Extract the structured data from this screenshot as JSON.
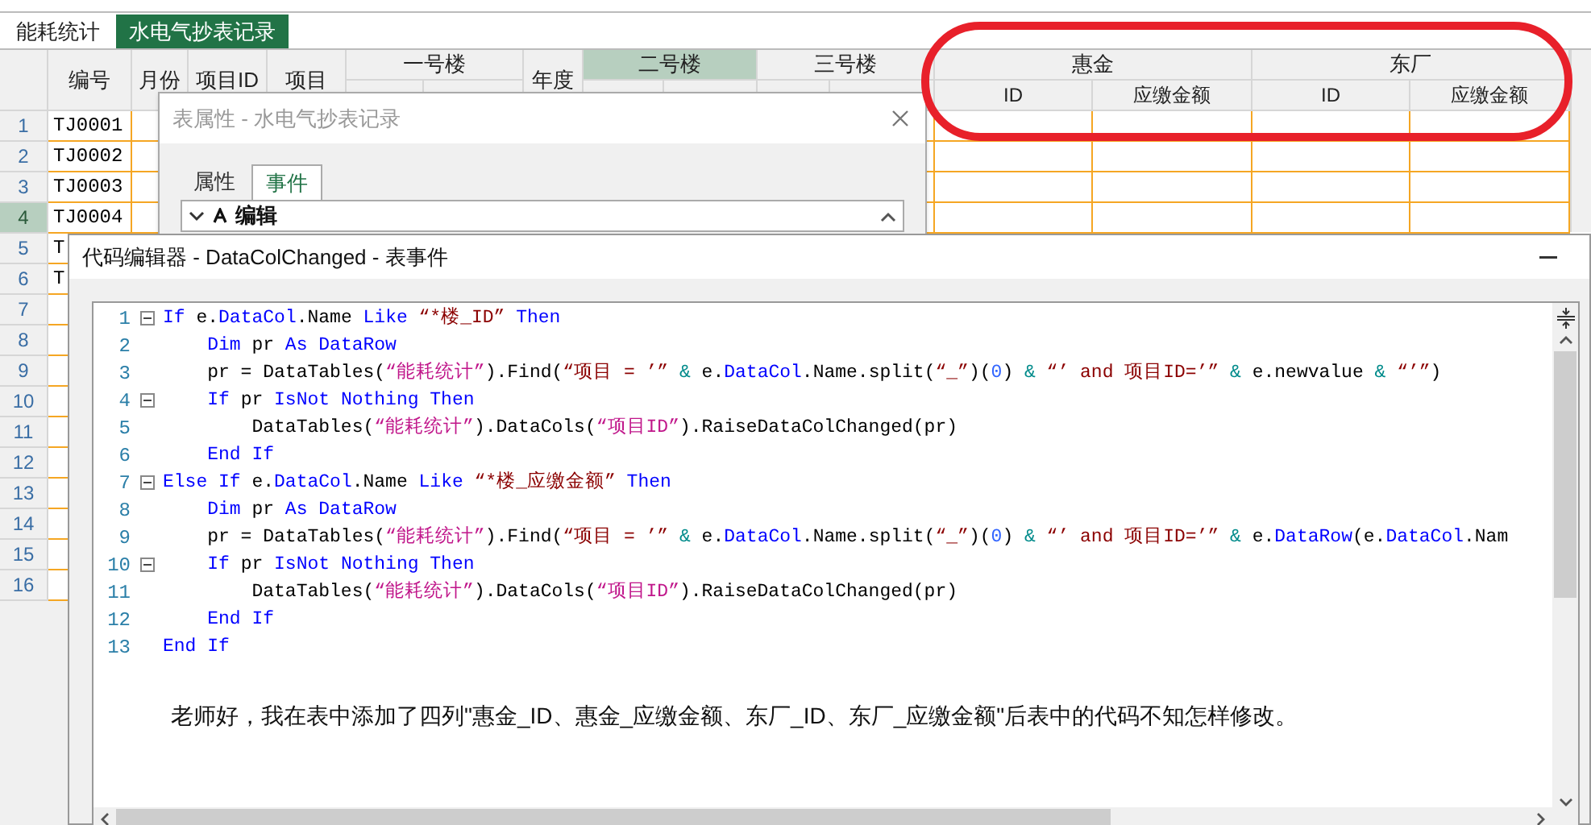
{
  "sheet_tabs": [
    {
      "label": "能耗统计",
      "selected": false
    },
    {
      "label": "水电气抄表记录",
      "selected": true
    }
  ],
  "grid": {
    "headers": [
      {
        "kind": "single",
        "label": "编号",
        "selected": false
      },
      {
        "kind": "single",
        "label": "月份",
        "selected": false
      },
      {
        "kind": "single",
        "label": "项目ID",
        "selected": false
      },
      {
        "kind": "single",
        "label": "项目",
        "selected": false
      },
      {
        "kind": "group",
        "label": "一号楼",
        "selected": false
      },
      {
        "kind": "single",
        "label": "年度",
        "selected": false
      },
      {
        "kind": "group",
        "label": "二号楼",
        "selected": true
      },
      {
        "kind": "group",
        "label": "三号楼",
        "selected": false
      },
      {
        "kind": "group",
        "label": "惠金",
        "selected": false,
        "sub": [
          "ID",
          "应缴金额"
        ]
      },
      {
        "kind": "group",
        "label": "东厂",
        "selected": false,
        "sub": [
          "ID",
          "应缴金额"
        ]
      }
    ],
    "rows": [
      {
        "num": "1",
        "selected": false,
        "code": "TJ0001"
      },
      {
        "num": "2",
        "selected": false,
        "code": "TJ0002"
      },
      {
        "num": "3",
        "selected": false,
        "code": "TJ0003"
      },
      {
        "num": "4",
        "selected": true,
        "code": "TJ0004"
      },
      {
        "num": "5",
        "selected": false,
        "code": "T"
      },
      {
        "num": "6",
        "selected": false,
        "code": "T"
      },
      {
        "num": "7",
        "selected": false
      },
      {
        "num": "8",
        "selected": false
      },
      {
        "num": "9",
        "selected": false
      },
      {
        "num": "10",
        "selected": false
      },
      {
        "num": "11",
        "selected": false
      },
      {
        "num": "12",
        "selected": false
      },
      {
        "num": "13",
        "selected": false
      },
      {
        "num": "14",
        "selected": false
      },
      {
        "num": "15",
        "selected": false
      },
      {
        "num": "16",
        "selected": false
      }
    ]
  },
  "properties_dialog": {
    "title": "表属性 - 水电气抄表记录",
    "tabs": [
      {
        "label": "属性",
        "selected": false
      },
      {
        "label": "事件",
        "selected": true
      }
    ],
    "section": {
      "label": "编辑",
      "expanded": true
    }
  },
  "code_editor": {
    "title": "代码编辑器 - DataColChanged - 表事件",
    "lines": [
      {
        "num": "1",
        "fold": true,
        "tokens": [
          {
            "text": "If",
            "kind": "kw"
          },
          {
            "text": " e.",
            "kind": "tx"
          },
          {
            "text": "DataCol",
            "kind": "kw"
          },
          {
            "text": ".Name ",
            "kind": "tx"
          },
          {
            "text": "Like",
            "kind": "kw"
          },
          {
            "text": " “*楼_ID”",
            "kind": "str"
          },
          {
            "text": " Then",
            "kind": "kw"
          }
        ]
      },
      {
        "num": "2",
        "fold": false,
        "tokens": [
          {
            "text": "    Dim",
            "kind": "kw"
          },
          {
            "text": " pr ",
            "kind": "tx"
          },
          {
            "text": "As",
            "kind": "kw"
          },
          {
            "text": " DataRow",
            "kind": "kw"
          }
        ]
      },
      {
        "num": "3",
        "fold": false,
        "tokens": [
          {
            "text": "    pr = DataTables(",
            "kind": "tx"
          },
          {
            "text": "“能耗统计”",
            "kind": "cn"
          },
          {
            "text": ").Find(",
            "kind": "tx"
          },
          {
            "text": "“项目 = ’”",
            "kind": "str"
          },
          {
            "text": " &",
            "kind": "op"
          },
          {
            "text": " e.",
            "kind": "tx"
          },
          {
            "text": "DataCol",
            "kind": "kw"
          },
          {
            "text": ".Name.split(",
            "kind": "tx"
          },
          {
            "text": "“_”",
            "kind": "str"
          },
          {
            "text": ")(",
            "kind": "tx"
          },
          {
            "text": "0",
            "kind": "num"
          },
          {
            "text": ") ",
            "kind": "tx"
          },
          {
            "text": "&",
            "kind": "op"
          },
          {
            "text": " “’ and 项目ID=’”",
            "kind": "str"
          },
          {
            "text": " &",
            "kind": "op"
          },
          {
            "text": " e.newvalue ",
            "kind": "tx"
          },
          {
            "text": "&",
            "kind": "op"
          },
          {
            "text": " “’”",
            "kind": "str"
          },
          {
            "text": ")",
            "kind": "tx"
          }
        ]
      },
      {
        "num": "4",
        "fold": true,
        "tokens": [
          {
            "text": "    If",
            "kind": "kw"
          },
          {
            "text": " pr ",
            "kind": "tx"
          },
          {
            "text": "IsNot Nothing Then",
            "kind": "kw"
          }
        ]
      },
      {
        "num": "5",
        "fold": false,
        "tokens": [
          {
            "text": "        DataTables(",
            "kind": "tx"
          },
          {
            "text": "“能耗统计”",
            "kind": "cn"
          },
          {
            "text": ").DataCols(",
            "kind": "tx"
          },
          {
            "text": "“项目ID”",
            "kind": "cn"
          },
          {
            "text": ").RaiseDataColChanged(pr)",
            "kind": "tx"
          }
        ]
      },
      {
        "num": "6",
        "fold": false,
        "tokens": [
          {
            "text": "    End If",
            "kind": "kw"
          }
        ]
      },
      {
        "num": "7",
        "fold": true,
        "tokens": [
          {
            "text": "Else If",
            "kind": "kw"
          },
          {
            "text": " e.",
            "kind": "tx"
          },
          {
            "text": "DataCol",
            "kind": "kw"
          },
          {
            "text": ".Name ",
            "kind": "tx"
          },
          {
            "text": "Like",
            "kind": "kw"
          },
          {
            "text": " “*楼_应缴金额”",
            "kind": "str"
          },
          {
            "text": " Then",
            "kind": "kw"
          }
        ]
      },
      {
        "num": "8",
        "fold": false,
        "tokens": [
          {
            "text": "    Dim",
            "kind": "kw"
          },
          {
            "text": " pr ",
            "kind": "tx"
          },
          {
            "text": "As",
            "kind": "kw"
          },
          {
            "text": " DataRow",
            "kind": "kw"
          }
        ]
      },
      {
        "num": "9",
        "fold": false,
        "tokens": [
          {
            "text": "    pr = DataTables(",
            "kind": "tx"
          },
          {
            "text": "“能耗统计”",
            "kind": "cn"
          },
          {
            "text": ").Find(",
            "kind": "tx"
          },
          {
            "text": "“项目 = ’”",
            "kind": "str"
          },
          {
            "text": " &",
            "kind": "op"
          },
          {
            "text": " e.",
            "kind": "tx"
          },
          {
            "text": "DataCol",
            "kind": "kw"
          },
          {
            "text": ".Name.split(",
            "kind": "tx"
          },
          {
            "text": "“_”",
            "kind": "str"
          },
          {
            "text": ")(",
            "kind": "tx"
          },
          {
            "text": "0",
            "kind": "num"
          },
          {
            "text": ") ",
            "kind": "tx"
          },
          {
            "text": "&",
            "kind": "op"
          },
          {
            "text": " “’ and 项目ID=’”",
            "kind": "str"
          },
          {
            "text": " &",
            "kind": "op"
          },
          {
            "text": " e.",
            "kind": "tx"
          },
          {
            "text": "DataRow",
            "kind": "kw"
          },
          {
            "text": "(e.",
            "kind": "tx"
          },
          {
            "text": "DataCol",
            "kind": "kw"
          },
          {
            "text": ".Nam",
            "kind": "tx"
          }
        ]
      },
      {
        "num": "10",
        "fold": true,
        "tokens": [
          {
            "text": "    If",
            "kind": "kw"
          },
          {
            "text": " pr ",
            "kind": "tx"
          },
          {
            "text": "IsNot Nothing Then",
            "kind": "kw"
          }
        ]
      },
      {
        "num": "11",
        "fold": false,
        "tokens": [
          {
            "text": "        DataTables(",
            "kind": "tx"
          },
          {
            "text": "“能耗统计”",
            "kind": "cn"
          },
          {
            "text": ").DataCols(",
            "kind": "tx"
          },
          {
            "text": "“项目ID”",
            "kind": "cn"
          },
          {
            "text": ").RaiseDataColChanged(pr)",
            "kind": "tx"
          }
        ]
      },
      {
        "num": "12",
        "fold": false,
        "tokens": [
          {
            "text": "    End If",
            "kind": "kw"
          }
        ]
      },
      {
        "num": "13",
        "fold": false,
        "tokens": [
          {
            "text": "End If",
            "kind": "kw"
          }
        ]
      }
    ],
    "message": "老师好，我在表中添加了四列\"惠金_ID、惠金_应缴金额、东厂_ID、东厂_应缴金额\"后表中的代码不知怎样修改。"
  }
}
